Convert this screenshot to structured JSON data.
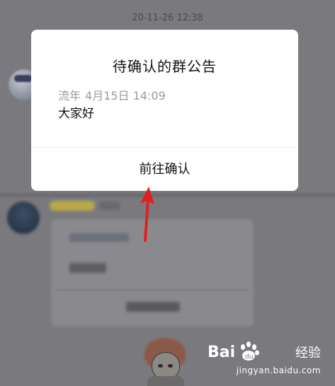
{
  "chat": {
    "timestamp": "20-11-26 12:38"
  },
  "dialog": {
    "title": "待确认的群公告",
    "author": "流年",
    "date": "4月15日 14:09",
    "content": "大家好",
    "confirm_label": "前往确认"
  },
  "annotation": {
    "arrow_color": "#e02020"
  },
  "watermark": {
    "brand": "Bai••••",
    "label": "经验",
    "domain": "jingyan.baidu.com"
  },
  "colors": {
    "overlay_background": "#7a7a7e",
    "dialog_background": "#ffffff",
    "meta_text": "#9b9b9b",
    "title_text": "#111111"
  }
}
